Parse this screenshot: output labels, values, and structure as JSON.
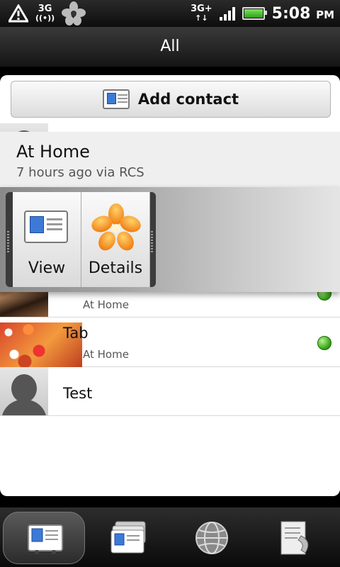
{
  "status_bar": {
    "network_label": "3G",
    "network_label_2": "3G+",
    "time": "5:08",
    "ampm": "PM"
  },
  "title": "All",
  "add_contact_label": "Add contact",
  "popup": {
    "title": "At Home",
    "subtitle": "7 hours ago via RCS",
    "actions": [
      {
        "label": "View",
        "icon": "contact-card-icon"
      },
      {
        "label": "Details",
        "icon": "flower-icon"
      }
    ]
  },
  "contacts": [
    {
      "name": "",
      "status": "At Home",
      "online": true
    },
    {
      "name": "Tab",
      "status": "At Home",
      "online": true
    },
    {
      "name": "Test",
      "status": "",
      "online": false
    }
  ],
  "tabs": [
    {
      "name": "people",
      "icon": "contact-card-icon",
      "selected": true
    },
    {
      "name": "groups",
      "icon": "group-cards-icon",
      "selected": false
    },
    {
      "name": "online-directory",
      "icon": "globe-icon",
      "selected": false
    },
    {
      "name": "call-history",
      "icon": "call-log-icon",
      "selected": false
    }
  ],
  "colors": {
    "online_dot": "#2f9d14",
    "background": "#000000"
  }
}
